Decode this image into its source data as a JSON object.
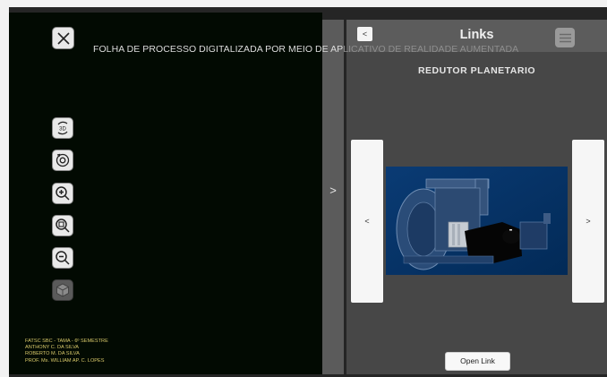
{
  "viewer": {
    "header_text": "FOLHA DE PROCESSO DIGITALIZADA POR MEIO DE AP",
    "header_text_faded": "LICATIVO DE REALIDADE AUMENTADA",
    "tools": {
      "close": "close-icon",
      "view3d": "3D",
      "rotate": "rotate-icon",
      "zoom_in": "zoom-in-icon",
      "zoom_fit": "zoom-fit-icon",
      "zoom_out": "zoom-out-icon",
      "cube": "cube-icon"
    },
    "credits": [
      "FATSC SBC - TAMA - 6º SEMESTRE",
      "ANTHONY C. DA SILVA",
      "ROBERTO M. DA SILVA",
      "PROF. Ms. WILLIAM AP. C. LOPES"
    ]
  },
  "divider": {
    "arrow": ">"
  },
  "panel": {
    "back_label": "<",
    "title": "Links",
    "menu_icon": "hamburger-menu-icon",
    "subtitle": "REDUTOR PLANETARIO",
    "prev_label": "<",
    "next_label": ">",
    "image_alt": "planetary-reducer-3d-model",
    "open_link_label": "Open Link"
  },
  "colors": {
    "viewer_bg": "#020a02",
    "panel_bg": "#474747",
    "image_bg": "#04356a",
    "credits_text": "#d8c86a"
  }
}
